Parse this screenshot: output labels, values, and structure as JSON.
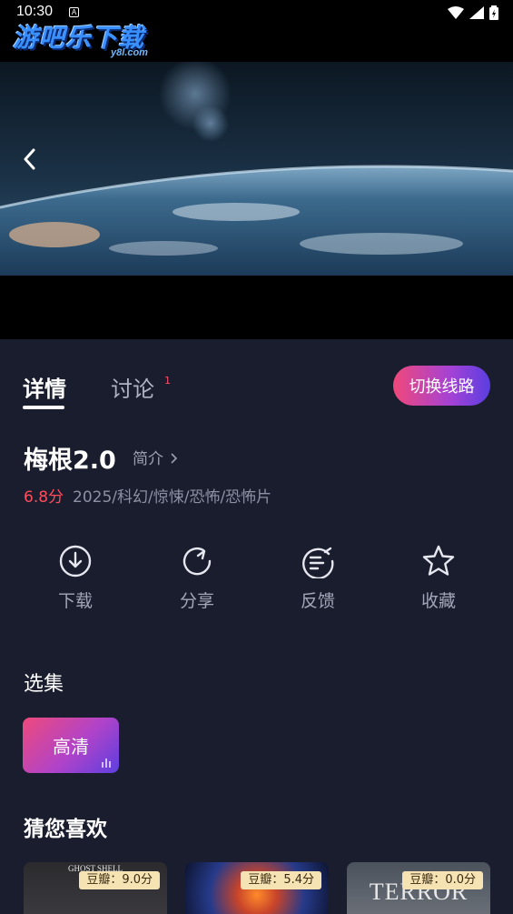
{
  "status_bar": {
    "time": "10:30",
    "indicator": "A"
  },
  "watermark": {
    "title": "游吧乐下载",
    "site": "y8l.com"
  },
  "player": {
    "back_icon": "chevron-left-icon"
  },
  "tabs": [
    {
      "label": "详情",
      "active": true
    },
    {
      "label": "讨论",
      "active": false,
      "badge": "1"
    }
  ],
  "switch_line_label": "切换线路",
  "movie": {
    "title": "梅根2.0",
    "intro_label": "简介",
    "score": "6.8分",
    "meta": "2025/科幻/惊悚/恐怖/恐怖片"
  },
  "actions": [
    {
      "label": "下载",
      "icon": "download-icon"
    },
    {
      "label": "分享",
      "icon": "share-icon"
    },
    {
      "label": "反馈",
      "icon": "feedback-icon"
    },
    {
      "label": "收藏",
      "icon": "star-icon"
    }
  ],
  "episodes": {
    "heading": "选集",
    "items": [
      {
        "label": "高清",
        "selected": true
      }
    ]
  },
  "recommend": {
    "heading": "猜您喜欢",
    "cards": [
      {
        "badge": "豆瓣：9.0分",
        "poster_text": "GHOST SHELL"
      },
      {
        "badge": "豆瓣：5.4分",
        "poster_text": ""
      },
      {
        "badge": "豆瓣：0.0分",
        "poster_text": "TERROR"
      }
    ]
  },
  "colors": {
    "background": "#1a1d2e",
    "accent_start": "#f0487a",
    "accent_end": "#5a3ee0",
    "score": "#ff4d5c"
  }
}
